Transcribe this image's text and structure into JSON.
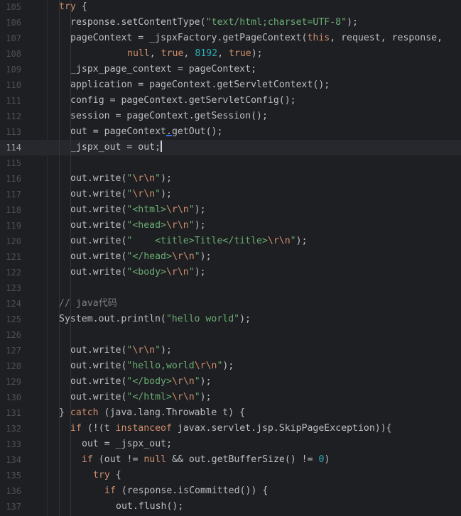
{
  "editor": {
    "first_line": 105,
    "current_line": 114,
    "lines": [
      {
        "n": 105,
        "indent": 2,
        "t": [
          [
            "kw",
            "try"
          ],
          [
            "p",
            " {"
          ]
        ]
      },
      {
        "n": 106,
        "indent": 3,
        "t": [
          [
            "p",
            "response.setContentType("
          ],
          [
            "str",
            "\"text/html;charset=UTF-8\""
          ],
          [
            "p",
            ");"
          ]
        ]
      },
      {
        "n": 107,
        "indent": 3,
        "t": [
          [
            "p",
            "pageContext = _jspxFactory.getPageContext("
          ],
          [
            "kw",
            "this"
          ],
          [
            "p",
            ", request, response,"
          ]
        ]
      },
      {
        "n": 108,
        "indent": 8,
        "t": [
          [
            "kw",
            "null"
          ],
          [
            "p",
            ", "
          ],
          [
            "kw",
            "true"
          ],
          [
            "p",
            ", "
          ],
          [
            "num",
            "8192"
          ],
          [
            "p",
            ", "
          ],
          [
            "kw",
            "true"
          ],
          [
            "p",
            ");"
          ]
        ]
      },
      {
        "n": 109,
        "indent": 3,
        "t": [
          [
            "p",
            "_jspx_page_context = pageContext;"
          ]
        ]
      },
      {
        "n": 110,
        "indent": 3,
        "t": [
          [
            "p",
            "application = pageContext.getServletContext();"
          ]
        ]
      },
      {
        "n": 111,
        "indent": 3,
        "t": [
          [
            "p",
            "config = pageContext.getServletConfig();"
          ]
        ]
      },
      {
        "n": 112,
        "indent": 3,
        "t": [
          [
            "p",
            "session = pageContext.getSession();"
          ]
        ]
      },
      {
        "n": 113,
        "indent": 3,
        "t": [
          [
            "p",
            "out = pageContext"
          ],
          [
            "dot",
            "."
          ],
          [
            "p",
            "getOut();"
          ]
        ]
      },
      {
        "n": 114,
        "indent": 3,
        "t": [
          [
            "p",
            "_jspx_out = out;"
          ],
          [
            "caret",
            ""
          ]
        ]
      },
      {
        "n": 115,
        "indent": 3,
        "t": []
      },
      {
        "n": 116,
        "indent": 3,
        "t": [
          [
            "p",
            "out.write("
          ],
          [
            "str",
            "\""
          ],
          [
            "esc",
            "\\r\\n"
          ],
          [
            "str",
            "\""
          ],
          [
            "p",
            ");"
          ]
        ]
      },
      {
        "n": 117,
        "indent": 3,
        "t": [
          [
            "p",
            "out.write("
          ],
          [
            "str",
            "\""
          ],
          [
            "esc",
            "\\r\\n"
          ],
          [
            "str",
            "\""
          ],
          [
            "p",
            ");"
          ]
        ]
      },
      {
        "n": 118,
        "indent": 3,
        "t": [
          [
            "p",
            "out.write("
          ],
          [
            "str",
            "\"<html>"
          ],
          [
            "esc",
            "\\r\\n"
          ],
          [
            "str",
            "\""
          ],
          [
            "p",
            ");"
          ]
        ]
      },
      {
        "n": 119,
        "indent": 3,
        "t": [
          [
            "p",
            "out.write("
          ],
          [
            "str",
            "\"<head>"
          ],
          [
            "esc",
            "\\r\\n"
          ],
          [
            "str",
            "\""
          ],
          [
            "p",
            ");"
          ]
        ]
      },
      {
        "n": 120,
        "indent": 3,
        "t": [
          [
            "p",
            "out.write("
          ],
          [
            "str",
            "\"    <title>Title</title>"
          ],
          [
            "esc",
            "\\r\\n"
          ],
          [
            "str",
            "\""
          ],
          [
            "p",
            ");"
          ]
        ]
      },
      {
        "n": 121,
        "indent": 3,
        "t": [
          [
            "p",
            "out.write("
          ],
          [
            "str",
            "\"</head>"
          ],
          [
            "esc",
            "\\r\\n"
          ],
          [
            "str",
            "\""
          ],
          [
            "p",
            ");"
          ]
        ]
      },
      {
        "n": 122,
        "indent": 3,
        "t": [
          [
            "p",
            "out.write("
          ],
          [
            "str",
            "\"<body>"
          ],
          [
            "esc",
            "\\r\\n"
          ],
          [
            "str",
            "\""
          ],
          [
            "p",
            ");"
          ]
        ]
      },
      {
        "n": 123,
        "indent": 3,
        "t": []
      },
      {
        "n": 124,
        "indent": 2,
        "t": [
          [
            "com",
            "// java代码"
          ]
        ]
      },
      {
        "n": 125,
        "indent": 2,
        "t": [
          [
            "p",
            "System.out.println("
          ],
          [
            "str",
            "\"hello world\""
          ],
          [
            "p",
            ");"
          ]
        ]
      },
      {
        "n": 126,
        "indent": 2,
        "t": []
      },
      {
        "n": 127,
        "indent": 3,
        "t": [
          [
            "p",
            "out.write("
          ],
          [
            "str",
            "\""
          ],
          [
            "esc",
            "\\r\\n"
          ],
          [
            "str",
            "\""
          ],
          [
            "p",
            ");"
          ]
        ]
      },
      {
        "n": 128,
        "indent": 3,
        "t": [
          [
            "p",
            "out.write("
          ],
          [
            "str",
            "\"hello,world"
          ],
          [
            "esc",
            "\\r\\n"
          ],
          [
            "str",
            "\""
          ],
          [
            "p",
            ");"
          ]
        ]
      },
      {
        "n": 129,
        "indent": 3,
        "t": [
          [
            "p",
            "out.write("
          ],
          [
            "str",
            "\"</body>"
          ],
          [
            "esc",
            "\\r\\n"
          ],
          [
            "str",
            "\""
          ],
          [
            "p",
            ");"
          ]
        ]
      },
      {
        "n": 130,
        "indent": 3,
        "t": [
          [
            "p",
            "out.write("
          ],
          [
            "str",
            "\"</html>"
          ],
          [
            "esc",
            "\\r\\n"
          ],
          [
            "str",
            "\""
          ],
          [
            "p",
            ");"
          ]
        ]
      },
      {
        "n": 131,
        "indent": 2,
        "t": [
          [
            "p",
            "} "
          ],
          [
            "kw",
            "catch"
          ],
          [
            "p",
            " (java.lang.Throwable t) {"
          ]
        ]
      },
      {
        "n": 132,
        "indent": 3,
        "t": [
          [
            "kw",
            "if"
          ],
          [
            "p",
            " (!(t "
          ],
          [
            "kw",
            "instanceof"
          ],
          [
            "p",
            " javax.servlet.jsp.SkipPageException)){"
          ]
        ]
      },
      {
        "n": 133,
        "indent": 4,
        "t": [
          [
            "p",
            "out = _jspx_out;"
          ]
        ]
      },
      {
        "n": 134,
        "indent": 4,
        "t": [
          [
            "kw",
            "if"
          ],
          [
            "p",
            " (out != "
          ],
          [
            "kw",
            "null"
          ],
          [
            "p",
            " && out.getBufferSize() != "
          ],
          [
            "num",
            "0"
          ],
          [
            "p",
            ")"
          ]
        ]
      },
      {
        "n": 135,
        "indent": 5,
        "t": [
          [
            "kw",
            "try"
          ],
          [
            "p",
            " {"
          ]
        ]
      },
      {
        "n": 136,
        "indent": 6,
        "t": [
          [
            "kw",
            "if"
          ],
          [
            "p",
            " (response.isCommitted()) {"
          ]
        ]
      },
      {
        "n": 137,
        "indent": 7,
        "t": [
          [
            "p",
            "out.flush();"
          ]
        ]
      }
    ]
  },
  "colors": {
    "background": "#1e1f22",
    "current_line": "#26282e",
    "keyword": "#cf8e6d",
    "string": "#6aab73",
    "number": "#2aacb8",
    "comment": "#7a7e85",
    "plain": "#bcbec4"
  }
}
